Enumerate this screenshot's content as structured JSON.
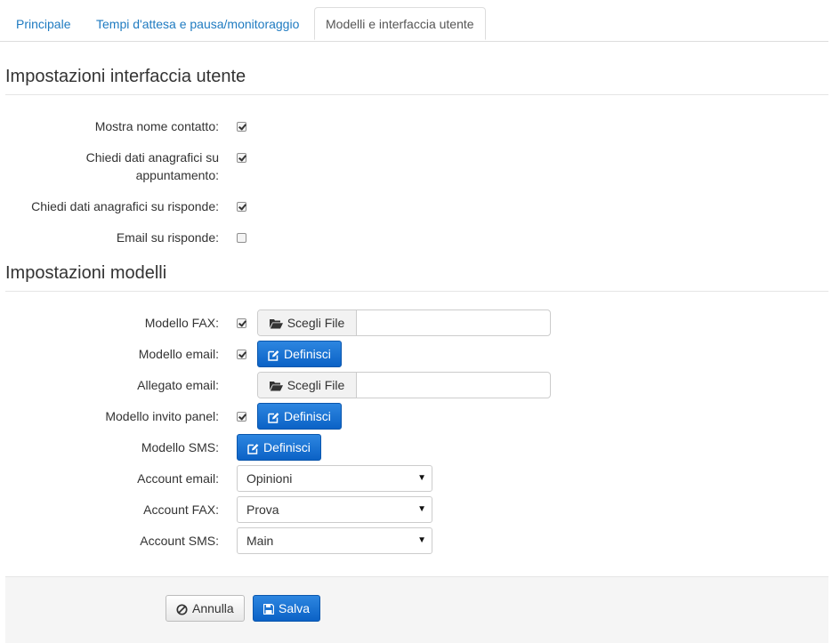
{
  "tabs": [
    {
      "label": "Principale",
      "active": false
    },
    {
      "label": "Tempi d'attesa e pausa/monitoraggio",
      "active": false
    },
    {
      "label": "Modelli e interfaccia utente",
      "active": true
    }
  ],
  "ui_section": {
    "title": "Impostazioni interfaccia utente",
    "fields": [
      {
        "label": "Mostra nome contatto:",
        "checked": true
      },
      {
        "label": "Chiedi dati anagrafici su appuntamento:",
        "checked": true
      },
      {
        "label": "Chiedi dati anagrafici su risponde:",
        "checked": true
      },
      {
        "label": "Email su risponde:",
        "checked": false
      }
    ]
  },
  "models_section": {
    "title": "Impostazioni modelli",
    "fax_label": "Modello FAX:",
    "email_label": "Modello email:",
    "attachment_label": "Allegato email:",
    "panel_label": "Modello invito panel:",
    "sms_label": "Modello SMS:",
    "choose_file": "Scegli File",
    "define": "Definisci",
    "account_email_label": "Account email:",
    "account_email_value": "Opinioni",
    "account_fax_label": "Account FAX:",
    "account_fax_value": "Prova",
    "account_sms_label": "Account SMS:",
    "account_sms_value": "Main"
  },
  "footer": {
    "cancel_label": "Annulla",
    "save_label": "Salva"
  },
  "colors": {
    "link": "#1f7bc1",
    "primary": "#0b62c6"
  }
}
